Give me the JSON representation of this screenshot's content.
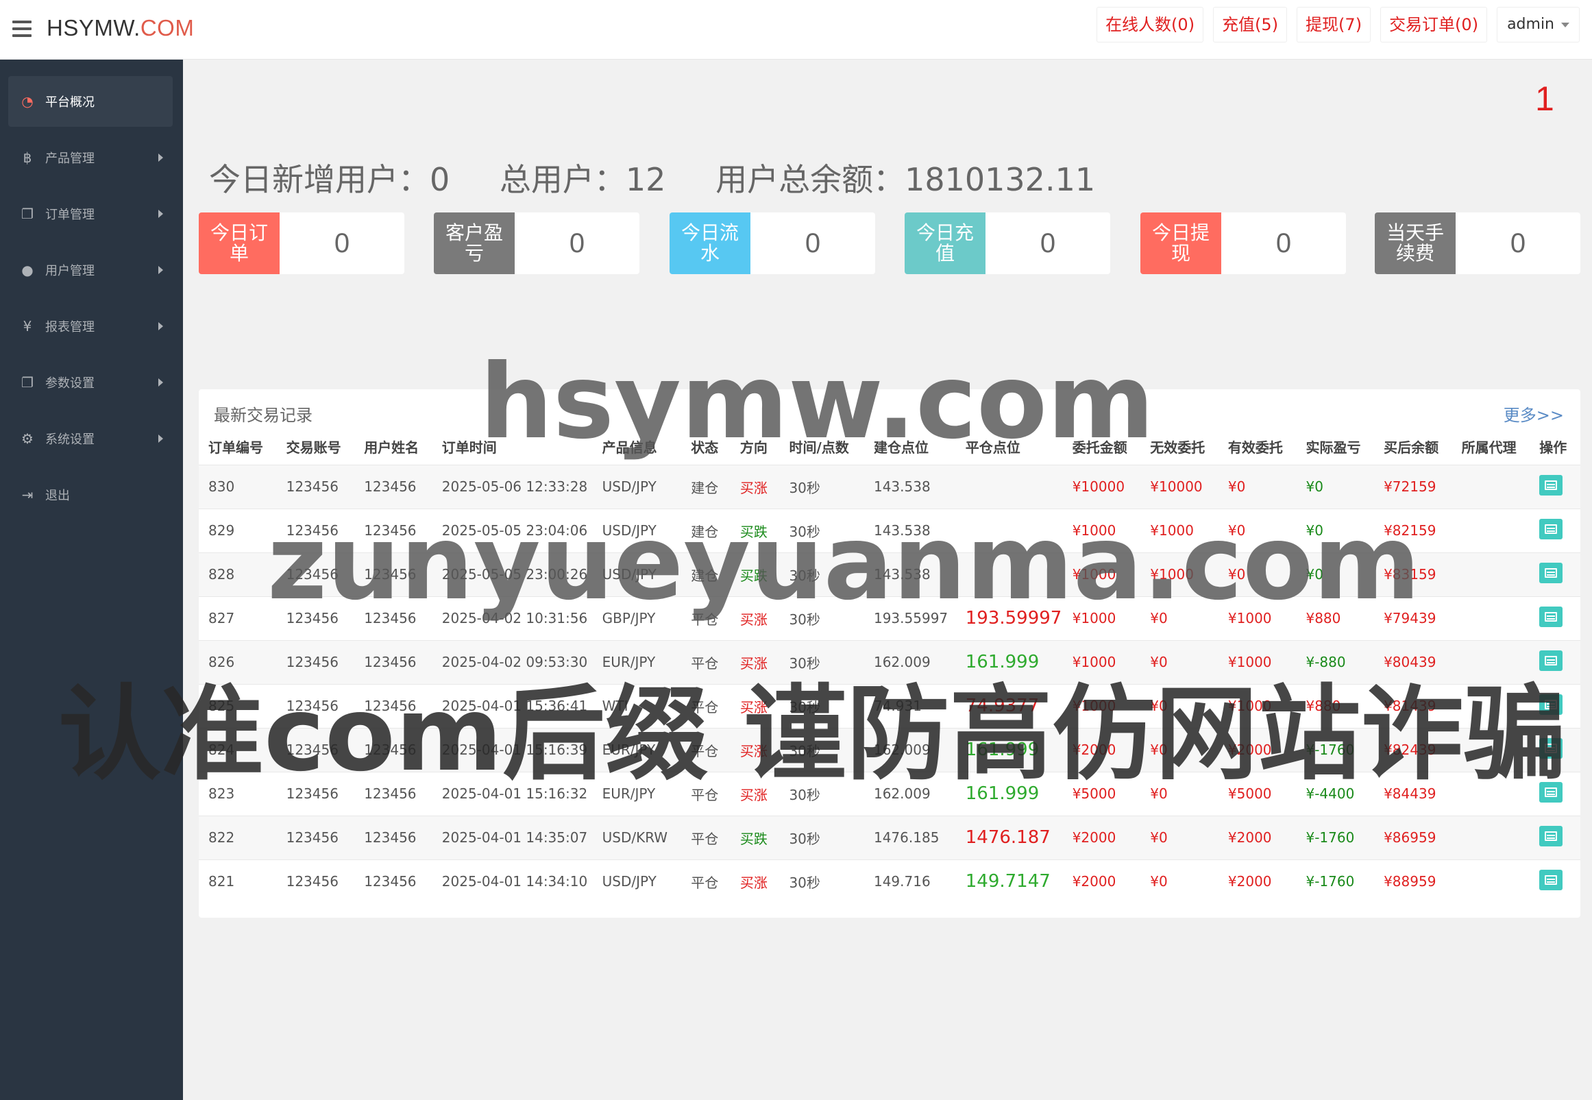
{
  "header": {
    "brand_main": "HSYMW.",
    "brand_accent": "COM",
    "online_label": "在线人数(0)",
    "recharge_label": "充值(5)",
    "withdraw_label": "提现(7)",
    "orders_label": "交易订单(0)",
    "user_label": "admin"
  },
  "sidebar": {
    "items": [
      {
        "label": "平台概况",
        "icon": "dashboard-icon"
      },
      {
        "label": "产品管理",
        "icon": "bitcoin-icon"
      },
      {
        "label": "订单管理",
        "icon": "copy-icon"
      },
      {
        "label": "用户管理",
        "icon": "user-icon"
      },
      {
        "label": "报表管理",
        "icon": "yen-icon"
      },
      {
        "label": "参数设置",
        "icon": "copy-icon"
      },
      {
        "label": "系统设置",
        "icon": "gears-icon"
      },
      {
        "label": "退出",
        "icon": "sign-out-icon"
      }
    ]
  },
  "badge_number": "1",
  "summary": {
    "new_users": "今日新增用户：0",
    "total_users": "总用户：12",
    "total_balance": "用户总余额：1810132.11"
  },
  "cards": [
    {
      "label": "今日订单",
      "value": "0",
      "color": "#ff6c60"
    },
    {
      "label": "客户盈亏",
      "value": "0",
      "color": "#7a7a7a"
    },
    {
      "label": "今日流水",
      "value": "0",
      "color": "#57c8f2"
    },
    {
      "label": "今日充值",
      "value": "0",
      "color": "#6ccac9"
    },
    {
      "label": "今日提现",
      "value": "0",
      "color": "#ff6c60"
    },
    {
      "label": "当天手续费",
      "value": "0",
      "color": "#7a7a7a"
    }
  ],
  "panel": {
    "title": "最新交易记录",
    "more": "更多>>",
    "columns": [
      "订单编号",
      "交易账号",
      "用户姓名",
      "订单时间",
      "产品信息",
      "状态",
      "方向",
      "时间/点数",
      "建仓点位",
      "平仓点位",
      "委托金额",
      "无效委托",
      "有效委托",
      "实际盈亏",
      "买后余额",
      "所属代理",
      "操作"
    ],
    "rows": [
      [
        "830",
        "123456",
        "123456",
        "2025-05-06 12:33:28",
        "USD/JPY",
        "建仓",
        "买涨",
        "30秒",
        "143.538",
        "",
        "¥10000",
        "¥10000",
        "¥0",
        "¥0",
        "¥72159",
        ""
      ],
      [
        "829",
        "123456",
        "123456",
        "2025-05-05 23:04:06",
        "USD/JPY",
        "建仓",
        "买跌",
        "30秒",
        "143.538",
        "",
        "¥1000",
        "¥1000",
        "¥0",
        "¥0",
        "¥82159",
        ""
      ],
      [
        "828",
        "123456",
        "123456",
        "2025-05-05 23:00:26",
        "USD/JPY",
        "建仓",
        "买跌",
        "30秒",
        "143.538",
        "",
        "¥1000",
        "¥1000",
        "¥0",
        "¥0",
        "¥83159",
        ""
      ],
      [
        "827",
        "123456",
        "123456",
        "2025-04-02 10:31:56",
        "GBP/JPY",
        "平仓",
        "买涨",
        "30秒",
        "193.55997",
        "193.59997",
        "¥1000",
        "¥0",
        "¥1000",
        "¥880",
        "¥79439",
        ""
      ],
      [
        "826",
        "123456",
        "123456",
        "2025-04-02 09:53:30",
        "EUR/JPY",
        "平仓",
        "买涨",
        "30秒",
        "162.009",
        "161.999",
        "¥1000",
        "¥0",
        "¥1000",
        "¥-880",
        "¥80439",
        ""
      ],
      [
        "825",
        "123456",
        "123456",
        "2025-04-01 15:36:41",
        "WTI",
        "平仓",
        "买涨",
        "30秒",
        "74.931",
        "74.9377",
        "¥1000",
        "¥0",
        "¥1000",
        "¥880",
        "¥81439",
        ""
      ],
      [
        "824",
        "123456",
        "123456",
        "2025-04-01 15:16:39",
        "EUR/JPY",
        "平仓",
        "买涨",
        "30秒",
        "162.009",
        "161.999",
        "¥2000",
        "¥0",
        "¥2000",
        "¥-1760",
        "¥82439",
        ""
      ],
      [
        "823",
        "123456",
        "123456",
        "2025-04-01 15:16:32",
        "EUR/JPY",
        "平仓",
        "买涨",
        "30秒",
        "162.009",
        "161.999",
        "¥5000",
        "¥0",
        "¥5000",
        "¥-4400",
        "¥84439",
        ""
      ],
      [
        "822",
        "123456",
        "123456",
        "2025-04-01 14:35:07",
        "USD/KRW",
        "平仓",
        "买跌",
        "30秒",
        "1476.185",
        "1476.187",
        "¥2000",
        "¥0",
        "¥2000",
        "¥-1760",
        "¥86959",
        ""
      ],
      [
        "821",
        "123456",
        "123456",
        "2025-04-01 14:34:10",
        "USD/JPY",
        "平仓",
        "买涨",
        "30秒",
        "149.716",
        "149.7147",
        "¥2000",
        "¥0",
        "¥2000",
        "¥-1760",
        "¥88959",
        ""
      ]
    ],
    "close_colors": [
      "",
      "",
      "",
      "red",
      "green",
      "red",
      "green",
      "green",
      "red",
      "green"
    ],
    "pnl_colors": [
      "green",
      "green",
      "green",
      "red",
      "green",
      "red",
      "green",
      "green",
      "green",
      "green"
    ]
  },
  "watermarks": [
    "hsymw.com",
    "zunyueyuanma.com",
    "认准com后缀 谨防高仿网站诈骗"
  ]
}
